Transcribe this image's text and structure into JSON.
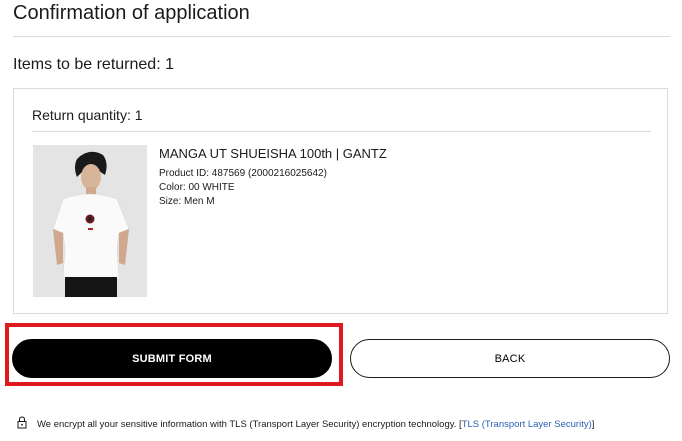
{
  "page": {
    "title": "Confirmation of application",
    "items_heading": "Items to be returned: 1"
  },
  "card": {
    "return_quantity": "Return quantity: 1",
    "product": {
      "name": "MANGA UT SHUEISHA 100th | GANTZ",
      "product_id": "Product ID: 487569 (2000216025642)",
      "color": "Color: 00 WHITE",
      "size": "Size: Men M"
    }
  },
  "actions": {
    "submit_label": "SUBMIT FORM",
    "back_label": "BACK"
  },
  "security": {
    "icon": "lock-icon",
    "text": "We encrypt all your sensitive information with TLS (Transport Layer Security) encryption technology. [",
    "link_text": "TLS (Transport Layer Security)",
    "close_bracket": "]"
  },
  "colors": {
    "highlight": "#e0191e",
    "primary_button": "#000000",
    "link": "#2a62b5"
  }
}
